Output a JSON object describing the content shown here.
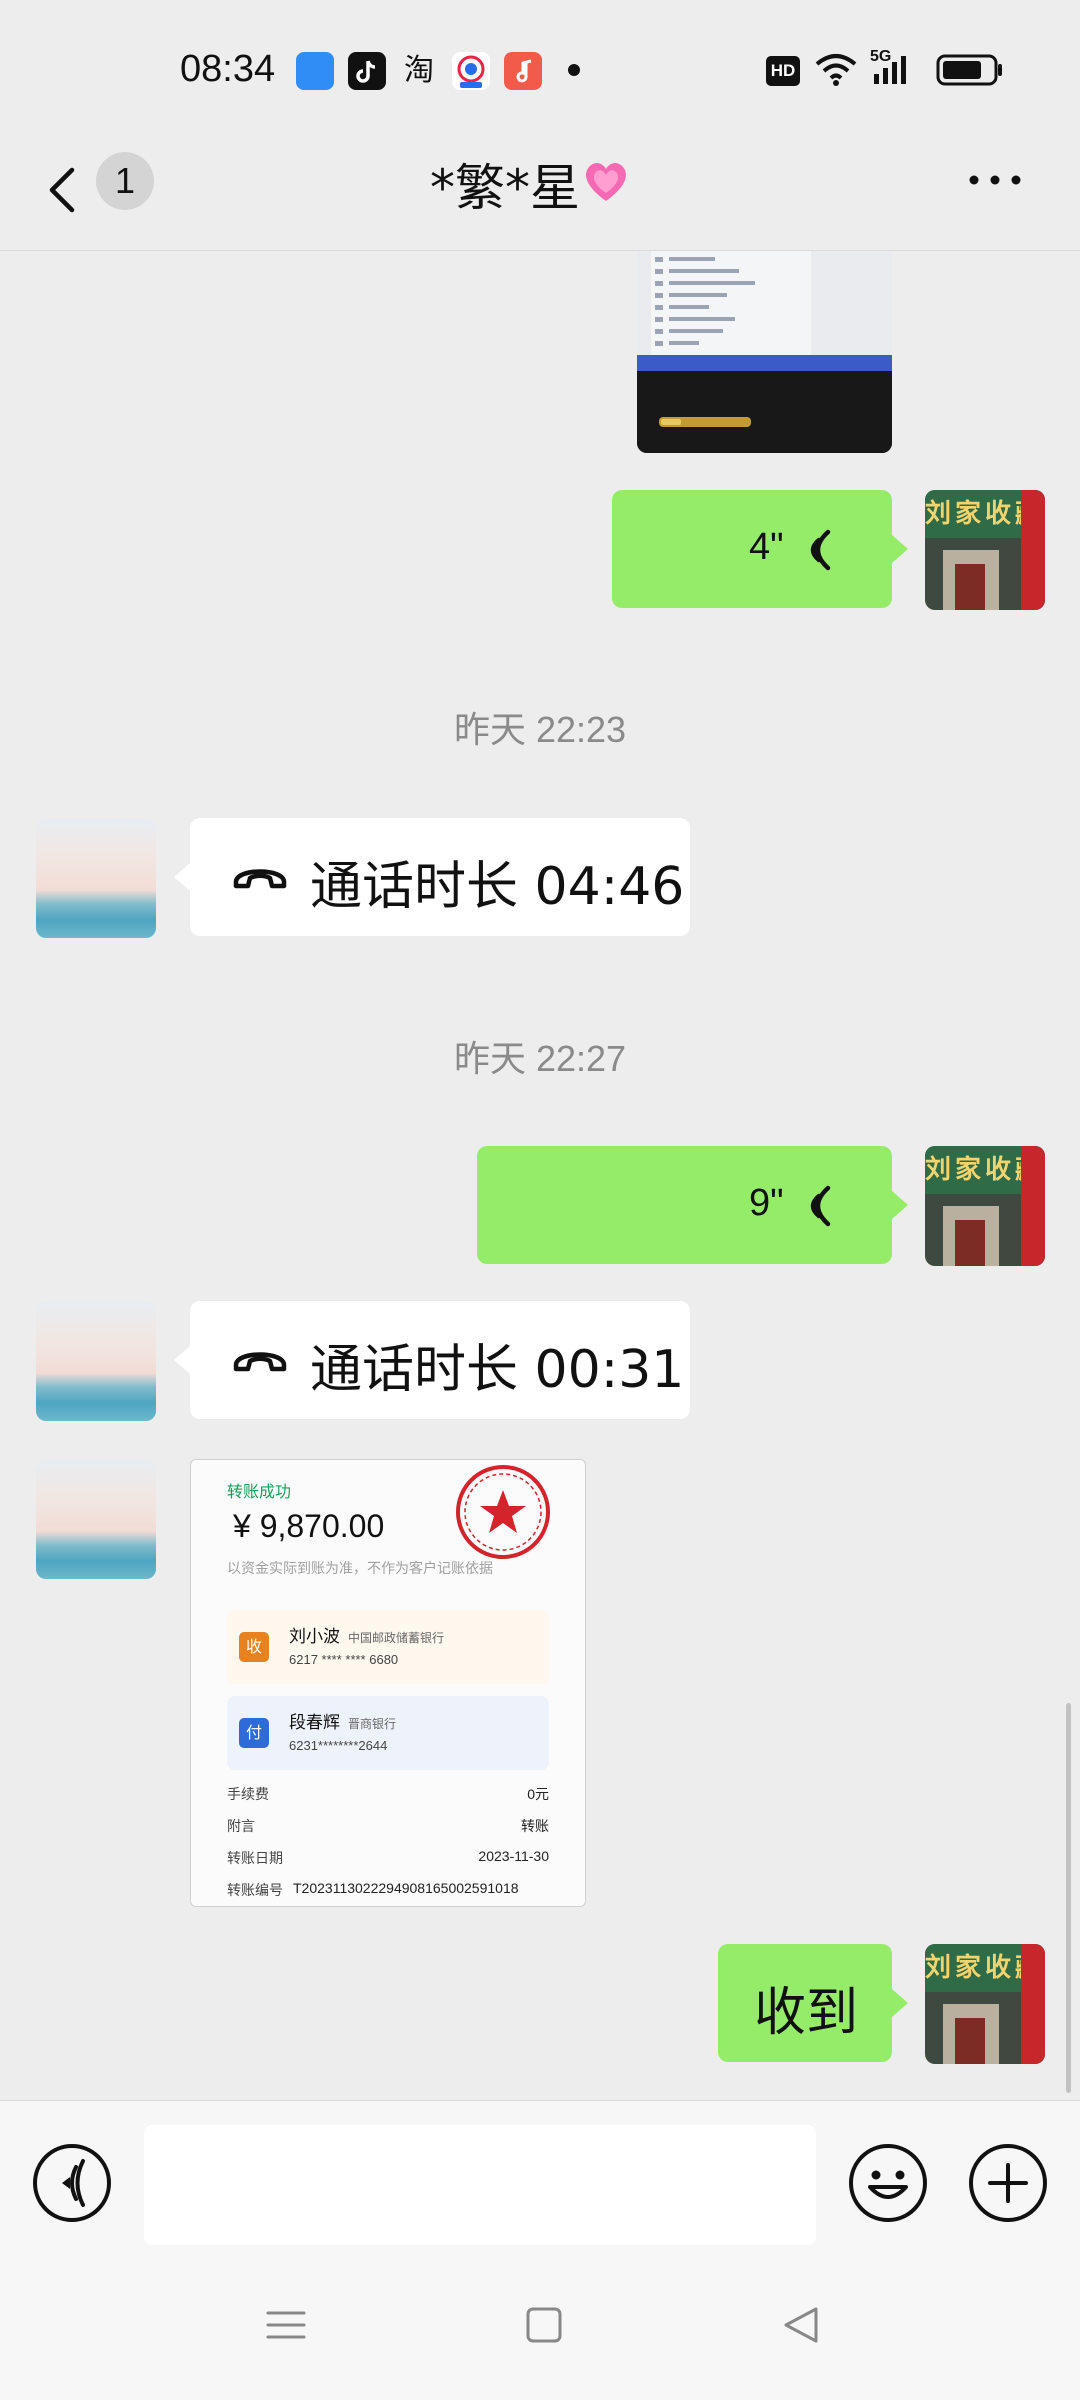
{
  "status_bar": {
    "time": "08:34",
    "app_icons": [
      "app-blue-icon",
      "tiktok-icon",
      "taobao-icon",
      "news-icon",
      "music-icon"
    ],
    "taobao_label": "淘",
    "hd_label": "HD",
    "network_label": "5G"
  },
  "header": {
    "unread_count": "1",
    "title": "*繁*星",
    "title_emoji": "heart-icon"
  },
  "messages": {
    "voice_1": {
      "duration": "4\""
    },
    "ts_1": "昨天 22:23",
    "call_1": {
      "text": "通话时长 04:46"
    },
    "ts_2": "昨天 22:27",
    "voice_2": {
      "duration": "9\""
    },
    "call_2": {
      "text": "通话时长 00:31"
    },
    "reply": {
      "text": "收到"
    }
  },
  "receipt": {
    "status": "转账成功",
    "amount": "¥ 9,870.00",
    "note": "以资金实际到账为准，不作为客户记账依据",
    "payee": {
      "badge": "收",
      "name": "刘小波",
      "bank": "中国邮政储蓄银行",
      "account": "6217 **** **** 6680"
    },
    "payer": {
      "badge": "付",
      "name": "段春辉",
      "bank": "晋商银行",
      "account": "6231********2644"
    },
    "fee_label": "手续费",
    "fee_value": "0元",
    "memo_label": "附言",
    "memo_value": "转账",
    "date_label": "转账日期",
    "date_value": "2023-11-30",
    "serial_label": "转账编号",
    "serial_value": "T2023113022294908165002591018"
  },
  "shop_avatar": {
    "sign_text": "刘家收藏"
  },
  "colors": {
    "background": "#ededed",
    "outgoing_bubble": "#95ec69",
    "incoming_bubble": "#ffffff",
    "success_green": "#18a05a",
    "seal_red": "#d4232b"
  }
}
